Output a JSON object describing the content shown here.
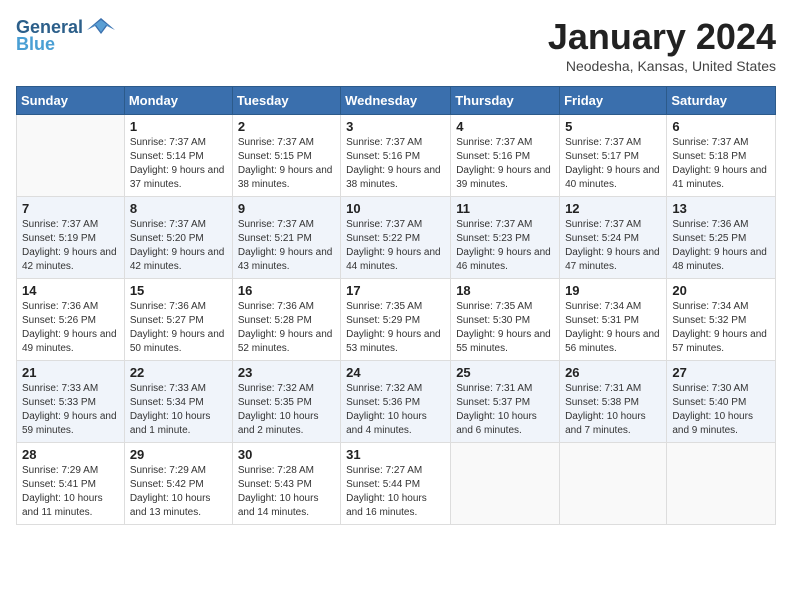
{
  "logo": {
    "general": "General",
    "blue": "Blue"
  },
  "title": "January 2024",
  "location": "Neodesha, Kansas, United States",
  "days_of_week": [
    "Sunday",
    "Monday",
    "Tuesday",
    "Wednesday",
    "Thursday",
    "Friday",
    "Saturday"
  ],
  "weeks": [
    [
      {
        "day": "",
        "sunrise": "",
        "sunset": "",
        "daylight": ""
      },
      {
        "day": "1",
        "sunrise": "Sunrise: 7:37 AM",
        "sunset": "Sunset: 5:14 PM",
        "daylight": "Daylight: 9 hours and 37 minutes."
      },
      {
        "day": "2",
        "sunrise": "Sunrise: 7:37 AM",
        "sunset": "Sunset: 5:15 PM",
        "daylight": "Daylight: 9 hours and 38 minutes."
      },
      {
        "day": "3",
        "sunrise": "Sunrise: 7:37 AM",
        "sunset": "Sunset: 5:16 PM",
        "daylight": "Daylight: 9 hours and 38 minutes."
      },
      {
        "day": "4",
        "sunrise": "Sunrise: 7:37 AM",
        "sunset": "Sunset: 5:16 PM",
        "daylight": "Daylight: 9 hours and 39 minutes."
      },
      {
        "day": "5",
        "sunrise": "Sunrise: 7:37 AM",
        "sunset": "Sunset: 5:17 PM",
        "daylight": "Daylight: 9 hours and 40 minutes."
      },
      {
        "day": "6",
        "sunrise": "Sunrise: 7:37 AM",
        "sunset": "Sunset: 5:18 PM",
        "daylight": "Daylight: 9 hours and 41 minutes."
      }
    ],
    [
      {
        "day": "7",
        "sunrise": "Sunrise: 7:37 AM",
        "sunset": "Sunset: 5:19 PM",
        "daylight": "Daylight: 9 hours and 42 minutes."
      },
      {
        "day": "8",
        "sunrise": "Sunrise: 7:37 AM",
        "sunset": "Sunset: 5:20 PM",
        "daylight": "Daylight: 9 hours and 42 minutes."
      },
      {
        "day": "9",
        "sunrise": "Sunrise: 7:37 AM",
        "sunset": "Sunset: 5:21 PM",
        "daylight": "Daylight: 9 hours and 43 minutes."
      },
      {
        "day": "10",
        "sunrise": "Sunrise: 7:37 AM",
        "sunset": "Sunset: 5:22 PM",
        "daylight": "Daylight: 9 hours and 44 minutes."
      },
      {
        "day": "11",
        "sunrise": "Sunrise: 7:37 AM",
        "sunset": "Sunset: 5:23 PM",
        "daylight": "Daylight: 9 hours and 46 minutes."
      },
      {
        "day": "12",
        "sunrise": "Sunrise: 7:37 AM",
        "sunset": "Sunset: 5:24 PM",
        "daylight": "Daylight: 9 hours and 47 minutes."
      },
      {
        "day": "13",
        "sunrise": "Sunrise: 7:36 AM",
        "sunset": "Sunset: 5:25 PM",
        "daylight": "Daylight: 9 hours and 48 minutes."
      }
    ],
    [
      {
        "day": "14",
        "sunrise": "Sunrise: 7:36 AM",
        "sunset": "Sunset: 5:26 PM",
        "daylight": "Daylight: 9 hours and 49 minutes."
      },
      {
        "day": "15",
        "sunrise": "Sunrise: 7:36 AM",
        "sunset": "Sunset: 5:27 PM",
        "daylight": "Daylight: 9 hours and 50 minutes."
      },
      {
        "day": "16",
        "sunrise": "Sunrise: 7:36 AM",
        "sunset": "Sunset: 5:28 PM",
        "daylight": "Daylight: 9 hours and 52 minutes."
      },
      {
        "day": "17",
        "sunrise": "Sunrise: 7:35 AM",
        "sunset": "Sunset: 5:29 PM",
        "daylight": "Daylight: 9 hours and 53 minutes."
      },
      {
        "day": "18",
        "sunrise": "Sunrise: 7:35 AM",
        "sunset": "Sunset: 5:30 PM",
        "daylight": "Daylight: 9 hours and 55 minutes."
      },
      {
        "day": "19",
        "sunrise": "Sunrise: 7:34 AM",
        "sunset": "Sunset: 5:31 PM",
        "daylight": "Daylight: 9 hours and 56 minutes."
      },
      {
        "day": "20",
        "sunrise": "Sunrise: 7:34 AM",
        "sunset": "Sunset: 5:32 PM",
        "daylight": "Daylight: 9 hours and 57 minutes."
      }
    ],
    [
      {
        "day": "21",
        "sunrise": "Sunrise: 7:33 AM",
        "sunset": "Sunset: 5:33 PM",
        "daylight": "Daylight: 9 hours and 59 minutes."
      },
      {
        "day": "22",
        "sunrise": "Sunrise: 7:33 AM",
        "sunset": "Sunset: 5:34 PM",
        "daylight": "Daylight: 10 hours and 1 minute."
      },
      {
        "day": "23",
        "sunrise": "Sunrise: 7:32 AM",
        "sunset": "Sunset: 5:35 PM",
        "daylight": "Daylight: 10 hours and 2 minutes."
      },
      {
        "day": "24",
        "sunrise": "Sunrise: 7:32 AM",
        "sunset": "Sunset: 5:36 PM",
        "daylight": "Daylight: 10 hours and 4 minutes."
      },
      {
        "day": "25",
        "sunrise": "Sunrise: 7:31 AM",
        "sunset": "Sunset: 5:37 PM",
        "daylight": "Daylight: 10 hours and 6 minutes."
      },
      {
        "day": "26",
        "sunrise": "Sunrise: 7:31 AM",
        "sunset": "Sunset: 5:38 PM",
        "daylight": "Daylight: 10 hours and 7 minutes."
      },
      {
        "day": "27",
        "sunrise": "Sunrise: 7:30 AM",
        "sunset": "Sunset: 5:40 PM",
        "daylight": "Daylight: 10 hours and 9 minutes."
      }
    ],
    [
      {
        "day": "28",
        "sunrise": "Sunrise: 7:29 AM",
        "sunset": "Sunset: 5:41 PM",
        "daylight": "Daylight: 10 hours and 11 minutes."
      },
      {
        "day": "29",
        "sunrise": "Sunrise: 7:29 AM",
        "sunset": "Sunset: 5:42 PM",
        "daylight": "Daylight: 10 hours and 13 minutes."
      },
      {
        "day": "30",
        "sunrise": "Sunrise: 7:28 AM",
        "sunset": "Sunset: 5:43 PM",
        "daylight": "Daylight: 10 hours and 14 minutes."
      },
      {
        "day": "31",
        "sunrise": "Sunrise: 7:27 AM",
        "sunset": "Sunset: 5:44 PM",
        "daylight": "Daylight: 10 hours and 16 minutes."
      },
      {
        "day": "",
        "sunrise": "",
        "sunset": "",
        "daylight": ""
      },
      {
        "day": "",
        "sunrise": "",
        "sunset": "",
        "daylight": ""
      },
      {
        "day": "",
        "sunrise": "",
        "sunset": "",
        "daylight": ""
      }
    ]
  ]
}
